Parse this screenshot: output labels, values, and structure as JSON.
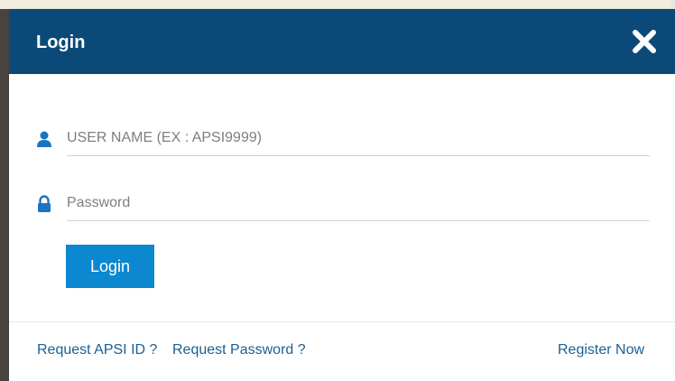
{
  "modal": {
    "title": "Login",
    "close_icon": "close-icon"
  },
  "form": {
    "username": {
      "icon": "user-icon",
      "placeholder": "USER NAME (EX : APSI9999)",
      "value": ""
    },
    "password": {
      "icon": "lock-icon",
      "placeholder": "Password",
      "value": ""
    },
    "login_button_label": "Login"
  },
  "footer": {
    "request_id_label": "Request APSI ID ?",
    "request_password_label": "Request Password ?",
    "register_label": "Register Now"
  },
  "colors": {
    "header_bg": "#0b4a78",
    "button_bg": "#0b88cf",
    "link": "#1a5f93",
    "icon": "#1a74c2"
  }
}
